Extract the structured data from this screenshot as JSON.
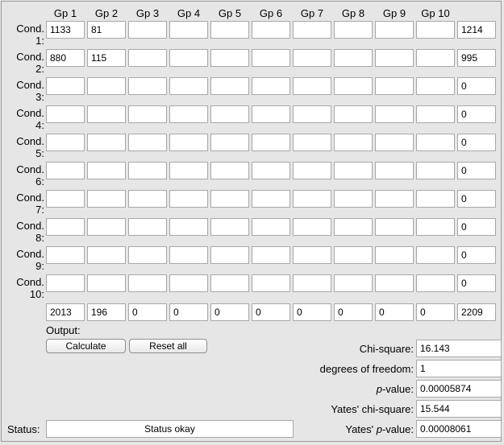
{
  "col_headers": [
    "Gp 1",
    "Gp 2",
    "Gp 3",
    "Gp 4",
    "Gp 5",
    "Gp 6",
    "Gp 7",
    "Gp 8",
    "Gp 9",
    "Gp 10"
  ],
  "row_labels": [
    [
      "Cond.",
      "1:"
    ],
    [
      "Cond.",
      "2:"
    ],
    [
      "Cond.",
      "3:"
    ],
    [
      "Cond.",
      "4:"
    ],
    [
      "Cond.",
      "5:"
    ],
    [
      "Cond.",
      "6:"
    ],
    [
      "Cond.",
      "7:"
    ],
    [
      "Cond.",
      "8:"
    ],
    [
      "Cond.",
      "9:"
    ],
    [
      "Cond.",
      "10:"
    ]
  ],
  "cells": [
    [
      "1133",
      "81",
      "",
      "",
      "",
      "",
      "",
      "",
      "",
      ""
    ],
    [
      "880",
      "115",
      "",
      "",
      "",
      "",
      "",
      "",
      "",
      ""
    ],
    [
      "",
      "",
      "",
      "",
      "",
      "",
      "",
      "",
      "",
      ""
    ],
    [
      "",
      "",
      "",
      "",
      "",
      "",
      "",
      "",
      "",
      ""
    ],
    [
      "",
      "",
      "",
      "",
      "",
      "",
      "",
      "",
      "",
      ""
    ],
    [
      "",
      "",
      "",
      "",
      "",
      "",
      "",
      "",
      "",
      ""
    ],
    [
      "",
      "",
      "",
      "",
      "",
      "",
      "",
      "",
      "",
      ""
    ],
    [
      "",
      "",
      "",
      "",
      "",
      "",
      "",
      "",
      "",
      ""
    ],
    [
      "",
      "",
      "",
      "",
      "",
      "",
      "",
      "",
      "",
      ""
    ],
    [
      "",
      "",
      "",
      "",
      "",
      "",
      "",
      "",
      "",
      ""
    ]
  ],
  "row_totals": [
    "1214",
    "995",
    "0",
    "0",
    "0",
    "0",
    "0",
    "0",
    "0",
    "0"
  ],
  "col_totals": [
    "2013",
    "196",
    "0",
    "0",
    "0",
    "0",
    "0",
    "0",
    "0",
    "0"
  ],
  "grand_total": "2209",
  "output_label": "Output:",
  "buttons": {
    "calculate": "Calculate",
    "reset": "Reset all"
  },
  "results": [
    {
      "label": "Chi-square:",
      "value": "16.143"
    },
    {
      "label": "degrees of freedom:",
      "value": "1"
    },
    {
      "label_italic": "p",
      "label_rest": "-value:",
      "value": "0.00005874"
    },
    {
      "label": "Yates' chi-square:",
      "value": "15.544"
    },
    {
      "label_prefix": "Yates' ",
      "label_italic": "p",
      "label_rest": "-value:",
      "value": "0.00008061"
    }
  ],
  "status": {
    "label": "Status:",
    "value": "Status okay"
  }
}
